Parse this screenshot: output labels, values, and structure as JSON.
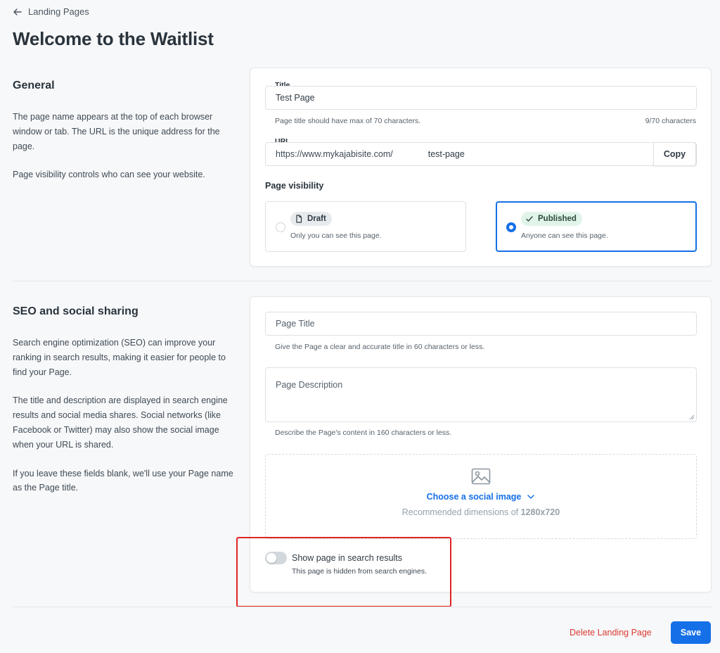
{
  "header": {
    "back_label": "Landing Pages",
    "page_title": "Welcome to the Waitlist"
  },
  "general": {
    "heading": "General",
    "desc_1": "The page name appears at the top of each browser window or tab. The URL is the unique address for the page.",
    "desc_2": "Page visibility controls who can see your website.",
    "title_label": "Title",
    "title_value": "Test Page",
    "title_hint": "Page title should have max of 70 characters.",
    "title_count": "9/70 characters",
    "url_label": "URL",
    "url_prefix": "https://www.mykajabisite.com/",
    "url_slug": "test-page",
    "copy_label": "Copy",
    "visibility_label": "Page visibility",
    "options": [
      {
        "badge": "Draft",
        "desc": "Only you can see this page.",
        "selected": false
      },
      {
        "badge": "Published",
        "desc": "Anyone can see this page.",
        "selected": true
      }
    ]
  },
  "seo": {
    "heading": "SEO and social sharing",
    "desc_1": "Search engine optimization (SEO) can improve your ranking in search results, making it easier for people to find your Page.",
    "desc_2": "The title and description are displayed in search engine results and social media shares. Social networks (like Facebook or Twitter) may also show the social image when your URL is shared.",
    "desc_3": "If you leave these fields blank, we'll use your Page name as the Page title.",
    "page_title_placeholder": "Page Title",
    "page_title_hint": "Give the Page a clear and accurate title in 60 characters or less.",
    "page_desc_placeholder": "Page Description",
    "page_desc_hint": "Describe the Page's content in 160 characters or less.",
    "choose_image": "Choose a social image",
    "recommended_prefix": "Recommended dimensions of ",
    "recommended_value": "1280x720",
    "toggle_label": "Show page in search results",
    "toggle_desc": "This page is hidden from search engines.",
    "toggle_on": false
  },
  "footer": {
    "delete_label": "Delete Landing Page",
    "save_label": "Save"
  },
  "colors": {
    "accent": "#1570e8",
    "danger": "#d93a30",
    "highlight": "#e02424",
    "published_badge_bg": "#e1f4e9"
  }
}
